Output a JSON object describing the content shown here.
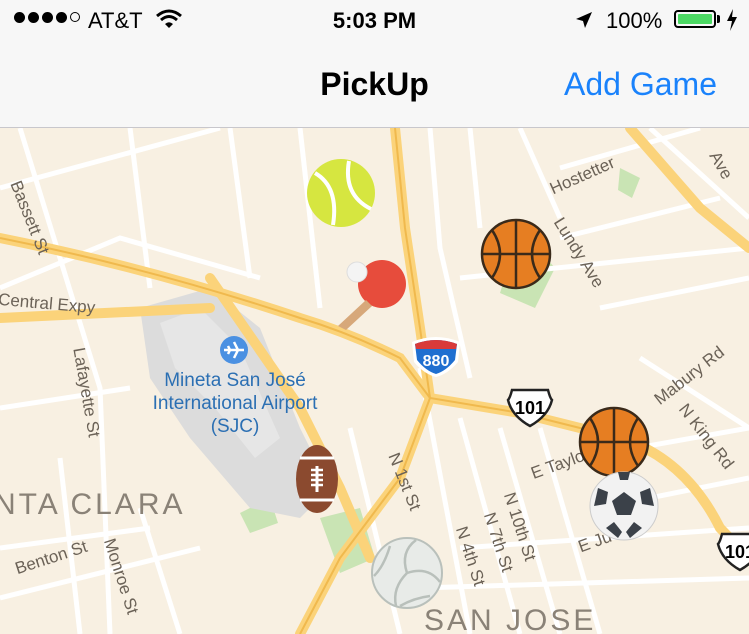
{
  "status_bar": {
    "carrier": "AT&T",
    "time": "5:03 PM",
    "battery_percent": "100%",
    "signal_bars": 4
  },
  "nav_bar": {
    "title": "PickUp",
    "action": "Add Game"
  },
  "map": {
    "street_labels": {
      "bassett": "Bassett St",
      "central_expy": "Central Expy",
      "lafayette": "Lafayette St",
      "benton": "Benton St",
      "monroe": "Monroe St",
      "hostetter": "Hostetter",
      "lundy": "Lundy Ave",
      "mabury": "Mabury Rd",
      "n_king": "N King Rd",
      "e_taylor": "E Taylor",
      "e_julian": "E Ju",
      "n_1st": "N 1st St",
      "n_4th": "N 4th St",
      "n_7th": "N 7th St",
      "n_10th": "N 10th St",
      "ave": "Ave"
    },
    "airport_label": "Mineta San José International Airport (SJC)",
    "city_labels": {
      "santa_clara": "NTA CLARA",
      "san_jose": "SAN JOSE"
    },
    "highway_shields": {
      "i880": "880",
      "us101": "101",
      "us101_edge": "101"
    },
    "game_pins": [
      {
        "sport": "tennis"
      },
      {
        "sport": "ping-pong"
      },
      {
        "sport": "basketball"
      },
      {
        "sport": "football"
      },
      {
        "sport": "basketball"
      },
      {
        "sport": "soccer"
      },
      {
        "sport": "volleyball"
      }
    ]
  }
}
